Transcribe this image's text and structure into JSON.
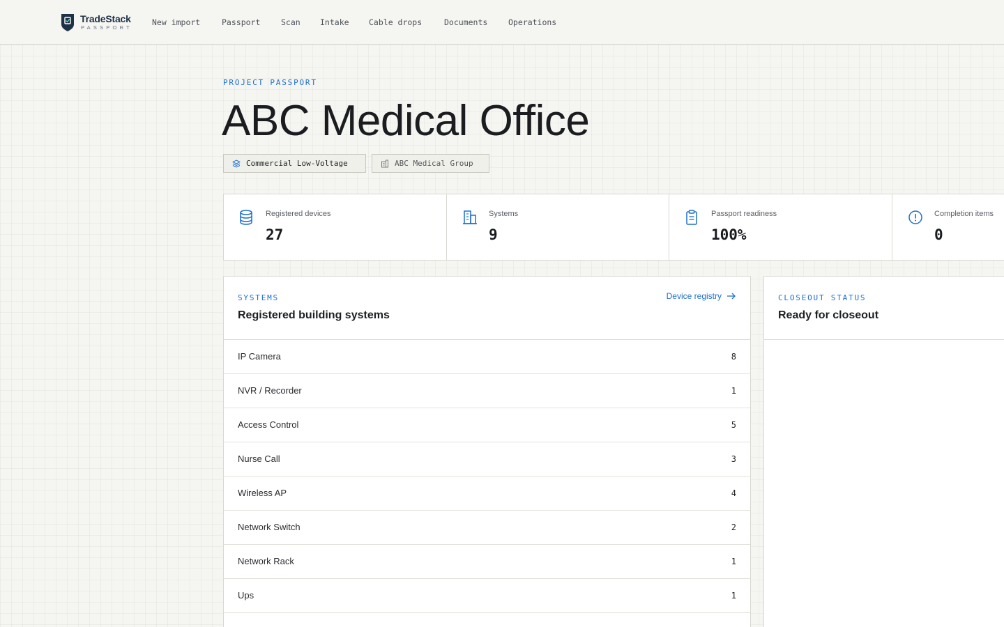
{
  "brand": {
    "name": "TradeStack",
    "sub": "PASSPORT"
  },
  "nav": [
    {
      "label": "New import"
    },
    {
      "label": "Passport"
    },
    {
      "label": "Scan"
    },
    {
      "label": "Intake"
    },
    {
      "label": "Cable drops"
    },
    {
      "label": "Documents"
    },
    {
      "label": "Operations"
    }
  ],
  "header": {
    "eyebrow": "PROJECT PASSPORT",
    "title": "ABC Medical Office",
    "tags": [
      {
        "label": "Commercial Low-Voltage",
        "icon": "layers-icon"
      },
      {
        "label": "ABC Medical Group",
        "icon": "building-icon"
      }
    ]
  },
  "stats": [
    {
      "label": "Registered devices",
      "value": "27",
      "icon": "database-icon"
    },
    {
      "label": "Systems",
      "value": "9",
      "icon": "buildings-icon"
    },
    {
      "label": "Passport readiness",
      "value": "100%",
      "icon": "clipboard-icon"
    },
    {
      "label": "Completion items",
      "value": "0",
      "icon": "alert-circle-icon"
    }
  ],
  "systems": {
    "eyebrow": "SYSTEMS",
    "title": "Registered building systems",
    "link": "Device registry",
    "rows": [
      {
        "name": "IP Camera",
        "count": "8"
      },
      {
        "name": "NVR / Recorder",
        "count": "1"
      },
      {
        "name": "Access Control",
        "count": "5"
      },
      {
        "name": "Nurse Call",
        "count": "3"
      },
      {
        "name": "Wireless AP",
        "count": "4"
      },
      {
        "name": "Network Switch",
        "count": "2"
      },
      {
        "name": "Network Rack",
        "count": "1"
      },
      {
        "name": "Ups",
        "count": "1"
      }
    ]
  },
  "closeout": {
    "eyebrow": "CLOSEOUT STATUS",
    "title": "Ready for closeout"
  },
  "colors": {
    "accent": "#1d6fd0",
    "brand": "#1f3147"
  }
}
